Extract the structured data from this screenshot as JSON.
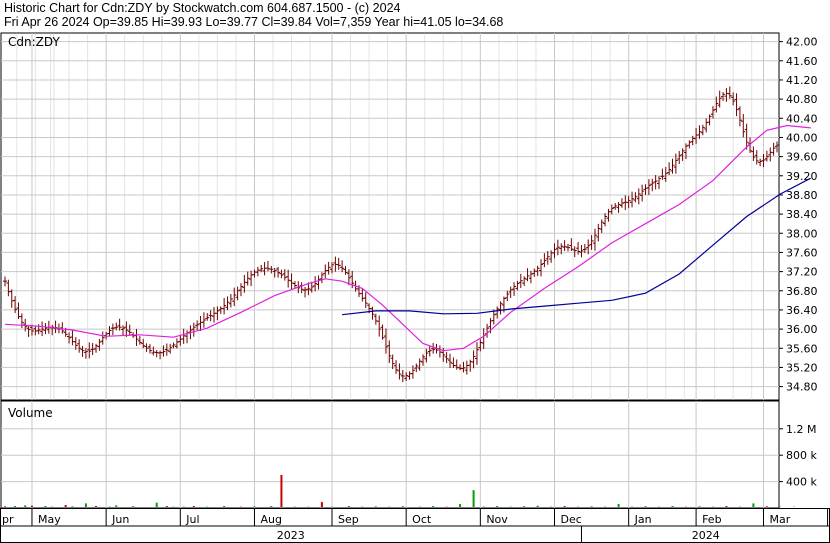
{
  "header": {
    "line1": "Historic Chart for Cdn:ZDY by Stockwatch.com 604.687.1500 - (c) 2024",
    "line2": "Fri Apr 26 2024  Op=39.85  Hi=39.93  Lo=39.77  Cl=39.84  Vol=7,359  Year hi=41.05  lo=34.68"
  },
  "chart_data": [
    {
      "type": "ohlc",
      "title": "Cdn:ZDY",
      "ylim": [
        34.52,
        42.18
      ],
      "y_ticks": [
        "42.00",
        "41.60",
        "41.20",
        "40.80",
        "40.40",
        "40.00",
        "39.60",
        "39.20",
        "38.80",
        "38.40",
        "38.00",
        "37.60",
        "37.20",
        "36.80",
        "36.40",
        "36.00",
        "35.60",
        "35.20",
        "34.80"
      ],
      "x_ticks": [
        "pr",
        "May",
        "Jun",
        "Jul",
        "Aug",
        "Sep",
        "Oct",
        "Nov",
        "Dec",
        "Jan",
        "Feb",
        "Mar",
        "Apr"
      ],
      "years": [
        "2023",
        "2024"
      ],
      "grid": true,
      "prices": [
        37.0,
        36.78,
        36.59,
        36.41,
        36.26,
        36.14,
        36.05,
        35.99,
        35.96,
        35.96,
        35.98,
        36.0,
        36.02,
        36.04,
        36.04,
        36.03,
        36.0,
        35.96,
        35.89,
        35.82,
        35.74,
        35.66,
        35.6,
        35.55,
        35.53,
        35.54,
        35.58,
        35.65,
        35.73,
        35.82,
        35.9,
        35.97,
        36.02,
        36.04,
        36.04,
        36.02,
        35.98,
        35.93,
        35.86,
        35.79,
        35.72,
        35.65,
        35.6,
        35.55,
        35.52,
        35.51,
        35.51,
        35.53,
        35.56,
        35.61,
        35.67,
        35.73,
        35.79,
        35.86,
        35.92,
        35.98,
        36.04,
        36.09,
        36.14,
        36.19,
        36.24,
        36.28,
        36.33,
        36.38,
        36.43,
        36.49,
        36.56,
        36.63,
        36.71,
        36.8,
        36.89,
        36.98,
        37.06,
        37.13,
        37.19,
        37.23,
        37.26,
        37.27,
        37.26,
        37.25,
        37.22,
        37.18,
        37.13,
        37.08,
        37.02,
        36.96,
        36.91,
        36.86,
        36.83,
        36.82,
        36.84,
        36.88,
        36.95,
        37.04,
        37.13,
        37.22,
        37.29,
        37.34,
        37.35,
        37.33,
        37.27,
        37.18,
        37.07,
        36.96,
        36.84,
        36.74,
        36.64,
        36.54,
        36.43,
        36.31,
        36.17,
        36.0,
        35.82,
        35.63,
        35.44,
        35.28,
        35.15,
        35.06,
        35.02,
        35.03,
        35.07,
        35.14,
        35.23,
        35.33,
        35.42,
        35.5,
        35.55,
        35.57,
        35.56,
        35.52,
        35.46,
        35.38,
        35.31,
        35.24,
        35.2,
        35.18,
        35.19,
        35.24,
        35.32,
        35.43,
        35.57,
        35.72,
        35.87,
        36.02,
        36.17,
        36.3,
        36.42,
        36.53,
        36.64,
        36.73,
        36.82,
        36.89,
        36.95,
        37.01,
        37.06,
        37.11,
        37.15,
        37.21,
        37.27,
        37.35,
        37.43,
        37.51,
        37.59,
        37.66,
        37.71,
        37.73,
        37.72,
        37.7,
        37.67,
        37.64,
        37.62,
        37.63,
        37.67,
        37.74,
        37.84,
        37.96,
        38.1,
        38.23,
        38.35,
        38.45,
        38.52,
        38.57,
        38.6,
        38.63,
        38.65,
        38.68,
        38.72,
        38.76,
        38.82,
        38.88,
        38.94,
        39.0,
        39.05,
        39.09,
        39.14,
        39.19,
        39.25,
        39.33,
        39.42,
        39.52,
        39.62,
        39.72,
        39.82,
        39.9,
        39.98,
        40.05,
        40.12,
        40.21,
        40.31,
        40.44,
        40.57,
        40.71,
        40.82,
        40.9,
        40.92,
        40.87,
        40.76,
        40.58,
        40.36,
        40.12,
        39.9,
        39.72,
        39.59,
        39.51,
        39.5,
        39.53,
        39.6,
        39.69,
        39.78,
        39.84
      ],
      "ma_short": [
        {
          "x": 0,
          "y": 36.1
        },
        {
          "x": 10,
          "y": 36.06
        },
        {
          "x": 20,
          "y": 35.98
        },
        {
          "x": 30,
          "y": 35.85
        },
        {
          "x": 40,
          "y": 35.88
        },
        {
          "x": 50,
          "y": 35.83
        },
        {
          "x": 60,
          "y": 36.02
        },
        {
          "x": 70,
          "y": 36.35
        },
        {
          "x": 80,
          "y": 36.7
        },
        {
          "x": 90,
          "y": 36.95
        },
        {
          "x": 95,
          "y": 37.05
        },
        {
          "x": 100,
          "y": 37.0
        },
        {
          "x": 106,
          "y": 36.85
        },
        {
          "x": 112,
          "y": 36.5
        },
        {
          "x": 118,
          "y": 36.1
        },
        {
          "x": 124,
          "y": 35.7
        },
        {
          "x": 130,
          "y": 35.55
        },
        {
          "x": 136,
          "y": 35.6
        },
        {
          "x": 142,
          "y": 35.85
        },
        {
          "x": 150,
          "y": 36.35
        },
        {
          "x": 160,
          "y": 36.85
        },
        {
          "x": 170,
          "y": 37.3
        },
        {
          "x": 180,
          "y": 37.8
        },
        {
          "x": 190,
          "y": 38.2
        },
        {
          "x": 200,
          "y": 38.6
        },
        {
          "x": 210,
          "y": 39.1
        },
        {
          "x": 220,
          "y": 39.8
        },
        {
          "x": 226,
          "y": 40.15
        },
        {
          "x": 232,
          "y": 40.25
        },
        {
          "x": 239,
          "y": 40.2
        }
      ],
      "ma_long": [
        {
          "x": 100,
          "y": 36.3
        },
        {
          "x": 110,
          "y": 36.38
        },
        {
          "x": 120,
          "y": 36.38
        },
        {
          "x": 130,
          "y": 36.32
        },
        {
          "x": 140,
          "y": 36.33
        },
        {
          "x": 150,
          "y": 36.42
        },
        {
          "x": 160,
          "y": 36.48
        },
        {
          "x": 170,
          "y": 36.54
        },
        {
          "x": 180,
          "y": 36.6
        },
        {
          "x": 190,
          "y": 36.75
        },
        {
          "x": 200,
          "y": 37.15
        },
        {
          "x": 210,
          "y": 37.75
        },
        {
          "x": 220,
          "y": 38.35
        },
        {
          "x": 230,
          "y": 38.82
        },
        {
          "x": 239,
          "y": 39.15
        }
      ]
    },
    {
      "type": "bar",
      "title": "Volume",
      "y_ticks": [
        "1.2 M",
        "800 k",
        "400 k"
      ],
      "ylim": [
        0,
        1500000
      ],
      "volumes": [
        {
          "x": 0,
          "v": 25000
        },
        {
          "x": 3,
          "v": 30000
        },
        {
          "x": 6,
          "v": 40000
        },
        {
          "x": 8,
          "v": 35000
        },
        {
          "x": 12,
          "v": 30000
        },
        {
          "x": 14,
          "v": 20000
        },
        {
          "x": 18,
          "v": 45000
        },
        {
          "x": 20,
          "v": 25000
        },
        {
          "x": 24,
          "v": 70000
        },
        {
          "x": 27,
          "v": 30000
        },
        {
          "x": 31,
          "v": 20000
        },
        {
          "x": 33,
          "v": 40000
        },
        {
          "x": 38,
          "v": 25000
        },
        {
          "x": 42,
          "v": 15000
        },
        {
          "x": 45,
          "v": 80000
        },
        {
          "x": 48,
          "v": 30000
        },
        {
          "x": 50,
          "v": 20000
        },
        {
          "x": 53,
          "v": 20000
        },
        {
          "x": 56,
          "v": 30000
        },
        {
          "x": 60,
          "v": 20000
        },
        {
          "x": 65,
          "v": 30000
        },
        {
          "x": 70,
          "v": 20000
        },
        {
          "x": 74,
          "v": 25000
        },
        {
          "x": 79,
          "v": 30000
        },
        {
          "x": 82,
          "v": 500000
        },
        {
          "x": 86,
          "v": 20000
        },
        {
          "x": 90,
          "v": 20000
        },
        {
          "x": 94,
          "v": 90000
        },
        {
          "x": 97,
          "v": 20000
        },
        {
          "x": 102,
          "v": 30000
        },
        {
          "x": 106,
          "v": 20000
        },
        {
          "x": 110,
          "v": 25000
        },
        {
          "x": 114,
          "v": 20000
        },
        {
          "x": 118,
          "v": 25000
        },
        {
          "x": 123,
          "v": 20000
        },
        {
          "x": 127,
          "v": 30000
        },
        {
          "x": 131,
          "v": 20000
        },
        {
          "x": 135,
          "v": 60000
        },
        {
          "x": 139,
          "v": 270000
        },
        {
          "x": 142,
          "v": 20000
        },
        {
          "x": 146,
          "v": 30000
        },
        {
          "x": 150,
          "v": 20000
        },
        {
          "x": 154,
          "v": 25000
        },
        {
          "x": 158,
          "v": 35000
        },
        {
          "x": 162,
          "v": 20000
        },
        {
          "x": 166,
          "v": 30000
        },
        {
          "x": 170,
          "v": 20000
        },
        {
          "x": 174,
          "v": 25000
        },
        {
          "x": 178,
          "v": 20000
        },
        {
          "x": 182,
          "v": 60000
        },
        {
          "x": 186,
          "v": 20000
        },
        {
          "x": 190,
          "v": 25000
        },
        {
          "x": 194,
          "v": 20000
        },
        {
          "x": 198,
          "v": 30000
        },
        {
          "x": 202,
          "v": 20000
        },
        {
          "x": 206,
          "v": 25000
        },
        {
          "x": 210,
          "v": 20000
        },
        {
          "x": 214,
          "v": 30000
        },
        {
          "x": 218,
          "v": 20000
        },
        {
          "x": 222,
          "v": 70000
        },
        {
          "x": 226,
          "v": 25000
        },
        {
          "x": 230,
          "v": 20000
        },
        {
          "x": 234,
          "v": 20000
        },
        {
          "x": 238,
          "v": 15000
        }
      ],
      "colors": {
        "up": "#00a000",
        "down": "#cc0000",
        "price": "#6b0000",
        "ma_short": "#e020e0",
        "ma_long": "#000099",
        "grid": "#c8c8c8"
      }
    }
  ]
}
